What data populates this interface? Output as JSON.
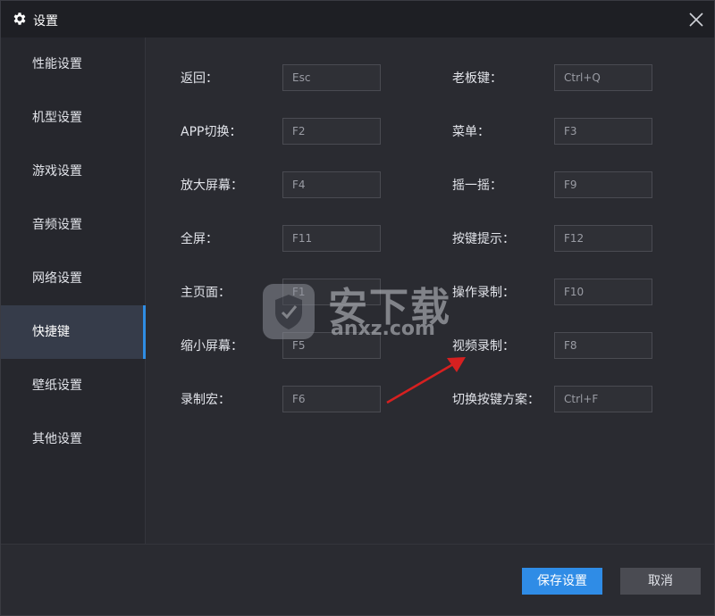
{
  "window": {
    "title": "设置"
  },
  "sidebar": {
    "items": [
      {
        "label": "性能设置",
        "active": false
      },
      {
        "label": "机型设置",
        "active": false
      },
      {
        "label": "游戏设置",
        "active": false
      },
      {
        "label": "音频设置",
        "active": false
      },
      {
        "label": "网络设置",
        "active": false
      },
      {
        "label": "快捷键",
        "active": true
      },
      {
        "label": "壁纸设置",
        "active": false
      },
      {
        "label": "其他设置",
        "active": false
      }
    ]
  },
  "shortcuts": {
    "left": [
      {
        "label": "返回：",
        "value": "Esc"
      },
      {
        "label": "APP切换：",
        "value": "F2"
      },
      {
        "label": "放大屏幕：",
        "value": "F4"
      },
      {
        "label": "全屏：",
        "value": "F11"
      },
      {
        "label": "主页面：",
        "value": "F1"
      },
      {
        "label": "缩小屏幕：",
        "value": "F5"
      },
      {
        "label": "录制宏：",
        "value": "F6"
      }
    ],
    "right": [
      {
        "label": "老板键：",
        "value": "Ctrl+Q"
      },
      {
        "label": "菜单：",
        "value": "F3"
      },
      {
        "label": "摇一摇：",
        "value": "F9"
      },
      {
        "label": "按键提示：",
        "value": "F12"
      },
      {
        "label": "操作录制：",
        "value": "F10"
      },
      {
        "label": "视频录制：",
        "value": "F8"
      },
      {
        "label": "切换按键方案：",
        "value": "Ctrl+F"
      }
    ]
  },
  "footer": {
    "save_label": "保存设置",
    "cancel_label": "取消"
  },
  "watermark": {
    "text_cn": "安下载",
    "text_en": "anxz.com"
  },
  "colors": {
    "accent": "#2f8ce6",
    "arrow": "#e02020"
  }
}
